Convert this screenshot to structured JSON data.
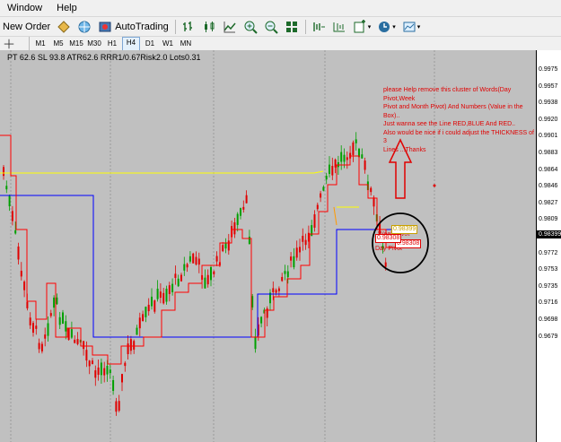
{
  "menu": {
    "window": "Window",
    "help": "Help"
  },
  "toolbar": {
    "new_order": "New Order",
    "autotrading": "AutoTrading"
  },
  "timeframes": [
    "M1",
    "M5",
    "M15",
    "M30",
    "H1",
    "H4",
    "D1",
    "W1",
    "MN"
  ],
  "active_timeframe": "H4",
  "chart": {
    "info_line": "PT 62.6  SL 93.8  ATR62.6  RRR1/0.67Risk2.0  Lots0.31",
    "annotation": "please Help remove this cluster of Words(Day Pivot,Week\nPivot and Month Pivot) And Numbers (Value in the Box)..\nJust wanna see the Line RED,BLUE And RED..\nAlso would be nice if i could adjust the THICKNESS of 3\nLines ...Thanks",
    "circle_label_1": "Day Pivot",
    "circle_label_2": "Week Pivot",
    "circle_value_1": "0.98308",
    "circle_value_2": "0.98399",
    "circle_value_3": "0.98308"
  },
  "price_axis": {
    "labels": [
      "0.9975",
      "0.9957",
      "0.9938",
      "0.9920",
      "0.9901",
      "0.9883",
      "0.9864",
      "0.9846",
      "0.9827",
      "0.9809",
      "0.9790",
      "0.9772",
      "0.9753",
      "0.9735",
      "0.9716",
      "0.9698",
      "0.9679"
    ],
    "current_price": "0.98399"
  },
  "colors": {
    "chart_bg": "#c0c0c0",
    "bull_candle": "#00a000",
    "bear_candle": "#e00000",
    "day_pivot": "#ff0000",
    "week_pivot": "#0000ff",
    "month_pivot": "#ffff00"
  }
}
